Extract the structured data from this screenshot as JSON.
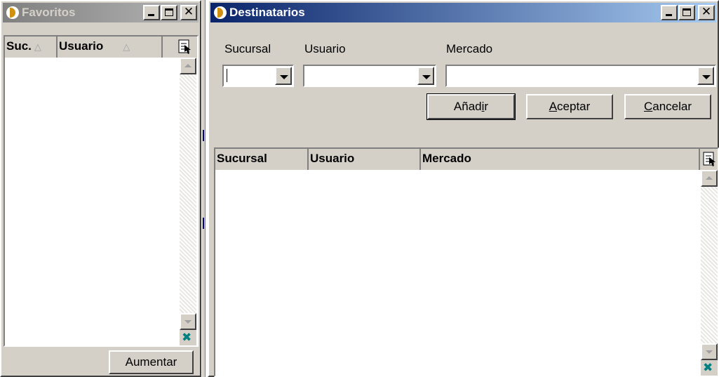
{
  "favoritos": {
    "title": "Favoritos",
    "columns": [
      "Suc.",
      "Usuario"
    ],
    "button": "Aumentar"
  },
  "destinatarios": {
    "title": "Destinatarios",
    "filters": {
      "sucursal_label": "Sucursal",
      "usuario_label": "Usuario",
      "mercado_label": "Mercado",
      "sucursal_value": "",
      "usuario_value": "",
      "mercado_value": ""
    },
    "buttons": {
      "add": {
        "pre": "Añad",
        "key": "i",
        "post": "r"
      },
      "accept": {
        "pre": "",
        "key": "A",
        "post": "ceptar"
      },
      "cancel": {
        "pre": "",
        "key": "C",
        "post": "ancelar"
      }
    },
    "columns": [
      "Sucursal",
      "Usuario",
      "Mercado"
    ]
  },
  "icons": {
    "app": "app-logo-icon",
    "minimize": "minimize-icon",
    "maximize": "maximize-icon",
    "close": "close-icon",
    "column_chooser": "column-chooser-icon",
    "grid_corner": "grid-corner-icon"
  },
  "colors": {
    "active_title": "#0a246a",
    "inactive_title": "#808080",
    "face": "#d4d0c8"
  }
}
